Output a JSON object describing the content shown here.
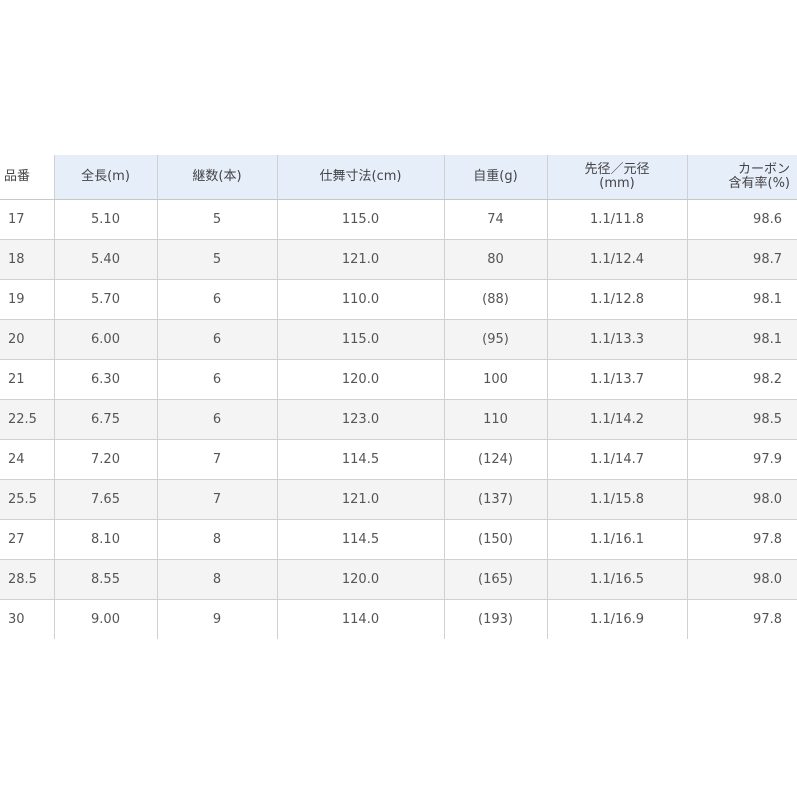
{
  "table": {
    "headers": [
      {
        "line1": "品番",
        "line2": ""
      },
      {
        "line1": "全長(m)",
        "line2": ""
      },
      {
        "line1": "継数(本)",
        "line2": ""
      },
      {
        "line1": "仕舞寸法(cm)",
        "line2": ""
      },
      {
        "line1": "自重(g)",
        "line2": ""
      },
      {
        "line1": "先径／元径",
        "line2": "(mm)"
      },
      {
        "line1": "カーボン",
        "line2": "含有率(%)"
      }
    ],
    "rows": [
      [
        "17",
        "5.10",
        "5",
        "115.0",
        "74",
        "1.1/11.8",
        "98.6"
      ],
      [
        "18",
        "5.40",
        "5",
        "121.0",
        "80",
        "1.1/12.4",
        "98.7"
      ],
      [
        "19",
        "5.70",
        "6",
        "110.0",
        "(88)",
        "1.1/12.8",
        "98.1"
      ],
      [
        "20",
        "6.00",
        "6",
        "115.0",
        "(95)",
        "1.1/13.3",
        "98.1"
      ],
      [
        "21",
        "6.30",
        "6",
        "120.0",
        "100",
        "1.1/13.7",
        "98.2"
      ],
      [
        "22.5",
        "6.75",
        "6",
        "123.0",
        "110",
        "1.1/14.2",
        "98.5"
      ],
      [
        "24",
        "7.20",
        "7",
        "114.5",
        "(124)",
        "1.1/14.7",
        "97.9"
      ],
      [
        "25.5",
        "7.65",
        "7",
        "121.0",
        "(137)",
        "1.1/15.8",
        "98.0"
      ],
      [
        "27",
        "8.10",
        "8",
        "114.5",
        "(150)",
        "1.1/16.1",
        "97.8"
      ],
      [
        "28.5",
        "8.55",
        "8",
        "120.0",
        "(165)",
        "1.1/16.5",
        "98.0"
      ],
      [
        "30",
        "9.00",
        "9",
        "114.0",
        "(193)",
        "1.1/16.9",
        "97.8"
      ]
    ]
  },
  "colors": {
    "header_bg": "#e6eefa",
    "stripe_bg": "#f4f4f4",
    "grid_line": "#d0d0d0",
    "text": "#555555"
  }
}
